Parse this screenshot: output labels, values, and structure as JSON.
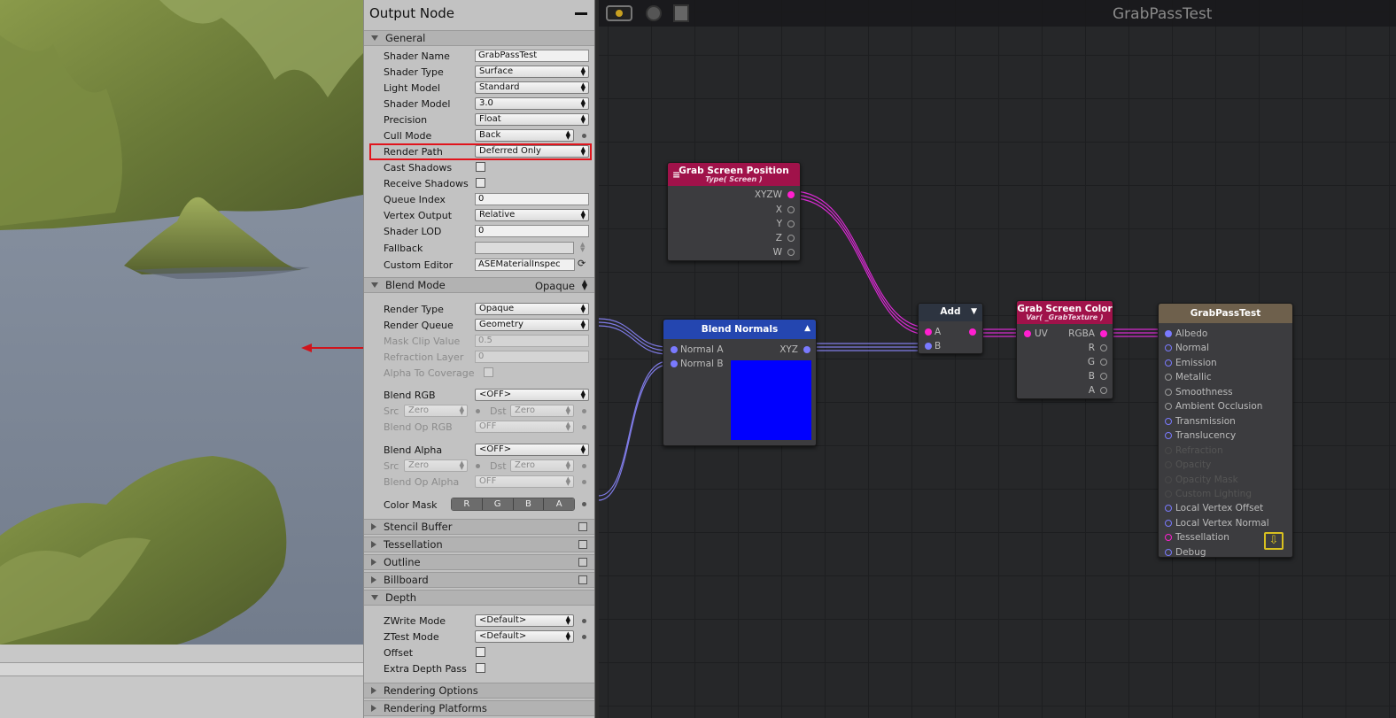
{
  "panel": {
    "title": "Output Node",
    "general": {
      "label": "General",
      "shader_name_label": "Shader Name",
      "shader_name": "GrabPassTest",
      "shader_type_label": "Shader Type",
      "shader_type": "Surface",
      "light_model_label": "Light Model",
      "light_model": "Standard",
      "shader_model_label": "Shader Model",
      "shader_model": "3.0",
      "precision_label": "Precision",
      "precision": "Float",
      "cull_mode_label": "Cull Mode",
      "cull_mode": "Back",
      "render_path_label": "Render Path",
      "render_path": "Deferred Only",
      "cast_shadows_label": "Cast Shadows",
      "receive_shadows_label": "Receive Shadows",
      "queue_index_label": "Queue Index",
      "queue_index": "0",
      "vertex_output_label": "Vertex Output",
      "vertex_output": "Relative",
      "shader_lod_label": "Shader LOD",
      "shader_lod": "0",
      "fallback_label": "Fallback",
      "fallback": "",
      "custom_editor_label": "Custom Editor",
      "custom_editor": "ASEMaterialInspec"
    },
    "blend_mode": {
      "label": "Blend Mode",
      "value": "Opaque",
      "render_type_label": "Render Type",
      "render_type": "Opaque",
      "render_queue_label": "Render Queue",
      "render_queue": "Geometry",
      "mask_clip_label": "Mask Clip Value",
      "mask_clip": "0.5",
      "refraction_layer_label": "Refraction Layer",
      "refraction_layer": "0",
      "alpha_to_coverage_label": "Alpha To Coverage",
      "blend_rgb_label": "Blend RGB",
      "blend_rgb": "<OFF>",
      "src_label": "Src",
      "dst_label": "Dst",
      "src_rgb": "Zero",
      "dst_rgb": "Zero",
      "blend_op_rgb_label": "Blend Op RGB",
      "blend_op_rgb": "OFF",
      "blend_alpha_label": "Blend Alpha",
      "blend_alpha": "<OFF>",
      "src_alpha": "Zero",
      "dst_alpha": "Zero",
      "blend_op_alpha_label": "Blend Op Alpha",
      "blend_op_alpha": "OFF",
      "color_mask_label": "Color Mask",
      "color_mask": [
        "R",
        "G",
        "B",
        "A"
      ]
    },
    "sections": {
      "stencil": "Stencil Buffer",
      "tessellation": "Tessellation",
      "outline": "Outline",
      "billboard": "Billboard",
      "depth": "Depth"
    },
    "depth": {
      "zwrite_label": "ZWrite Mode",
      "zwrite": "<Default>",
      "ztest_label": "ZTest Mode",
      "ztest": "<Default>",
      "offset_label": "Offset",
      "extra_depth_label": "Extra Depth Pass"
    },
    "rendering_options": "Rendering Options",
    "rendering_platforms": "Rendering Platforms"
  },
  "graph": {
    "title": "GrabPassTest",
    "nodes": {
      "grab_screen_position": {
        "title": "Grab Screen Position",
        "subtitle": "Type( Screen )",
        "outputs": [
          "XYZW",
          "X",
          "Y",
          "Z",
          "W"
        ]
      },
      "blend_normals": {
        "title": "Blend Normals",
        "inputs": [
          "Normal A",
          "Normal B"
        ],
        "output": "XYZ"
      },
      "add": {
        "title": "Add",
        "inputs": [
          "A",
          "B"
        ]
      },
      "grab_screen_color": {
        "title": "Grab Screen Color",
        "subtitle": "Var( _GrabTexture )",
        "input": "UV",
        "outputs": [
          "RGBA",
          "R",
          "G",
          "B",
          "A"
        ]
      },
      "output": {
        "title": "GrabPassTest",
        "inputs": [
          "Albedo",
          "Normal",
          "Emission",
          "Metallic",
          "Smoothness",
          "Ambient Occlusion",
          "Transmission",
          "Translucency",
          "Refraction",
          "Opacity",
          "Opacity Mask",
          "Custom Lighting",
          "Local Vertex Offset",
          "Local Vertex Normal",
          "Tessellation",
          "Debug"
        ]
      }
    }
  },
  "colors": {
    "highlight_box": "#e0141c",
    "annotation_arrow": "#d0141c",
    "wire": "#d62bd0",
    "normal_wire": "#7f7be6",
    "blend_preview": "#0000ff"
  }
}
